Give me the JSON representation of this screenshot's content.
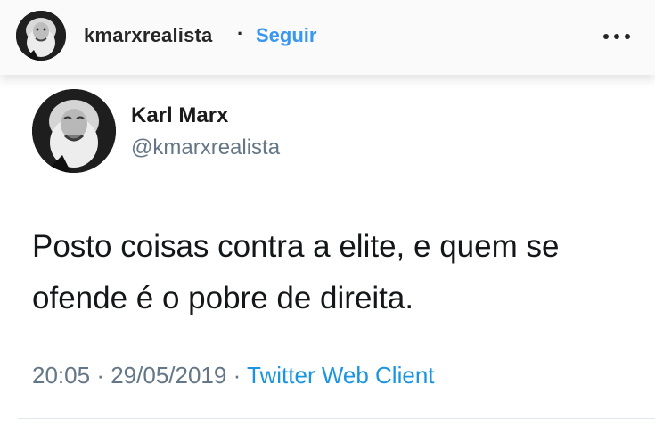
{
  "header": {
    "username": "kmarxrealista",
    "separator": "·",
    "follow_label": "Seguir",
    "avatar_icon": "karl-marx-avatar-icon",
    "more_icon": "more-options-icon"
  },
  "tweet": {
    "display_name": "Karl Marx",
    "handle": "@kmarxrealista",
    "text_lines": [
      "Posto coisas contra a elite, e quem se",
      "ofende é o pobre de direita."
    ],
    "time": "20:05",
    "date": "29/05/2019",
    "separator": "·",
    "client": "Twitter Web Client",
    "avatar_icon": "karl-marx-avatar-icon"
  },
  "colors": {
    "follow_blue": "#3897f0",
    "twitter_link_blue": "#1b95e0",
    "meta_gray": "#657786"
  }
}
